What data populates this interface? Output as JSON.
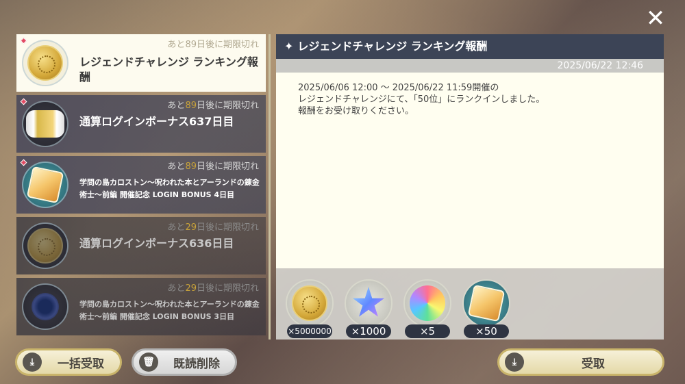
{
  "window": {
    "close_label": "✕"
  },
  "mail_list": [
    {
      "expiry_prefix": "あと",
      "expiry_num": "89",
      "expiry_suffix": "日後に期限切れ",
      "title": "レジェンドチャレンジ ランキング報酬",
      "icon": "gold-coin-icon",
      "state": "selected",
      "unread": true
    },
    {
      "expiry_prefix": "あと",
      "expiry_num": "89",
      "expiry_suffix": "日後に期限切れ",
      "title": "通算ログインボーナス637日目",
      "icon": "candy-icon",
      "state": "unread",
      "unread": true
    },
    {
      "expiry_prefix": "あと",
      "expiry_num": "89",
      "expiry_suffix": "日後に期限切れ",
      "title": "学問の島カロストン〜呪われた本とアーランドの錬金術士〜前編 開催記念 LOGIN BONUS 4日目",
      "icon": "cube-icon",
      "state": "unread",
      "unread": true
    },
    {
      "expiry_prefix": "あと",
      "expiry_num": "29",
      "expiry_suffix": "日後に期限切れ",
      "title": "通算ログインボーナス636日目",
      "icon": "gold-coin-icon",
      "state": "read",
      "unread": false
    },
    {
      "expiry_prefix": "あと",
      "expiry_num": "29",
      "expiry_suffix": "日後に期限切れ",
      "title": "学問の島カロストン〜呪われた本とアーランドの錬金術士〜前編 開催記念 LOGIN BONUS 3日目",
      "icon": "orb-icon",
      "state": "read",
      "unread": false
    }
  ],
  "detail": {
    "title": "レジェンドチャレンジ ランキング報酬",
    "date": "2025/06/22 12:46",
    "body_lines": [
      "2025/06/06 12:00 〜 2025/06/22 11:59開催の",
      "レジェンドチャレンジにて、「50位」にランクインしました。",
      "報酬をお受け取りください。"
    ],
    "rewards": [
      {
        "icon": "gold-coin-icon",
        "qty": "×5000000"
      },
      {
        "icon": "star-crystal-icon",
        "qty": "×1000"
      },
      {
        "icon": "rainbow-orb-icon",
        "qty": "×5"
      },
      {
        "icon": "cube-icon",
        "qty": "×50"
      }
    ]
  },
  "buttons": {
    "receive_all": "一括受取",
    "delete_read": "既読削除",
    "receive": "受取"
  }
}
